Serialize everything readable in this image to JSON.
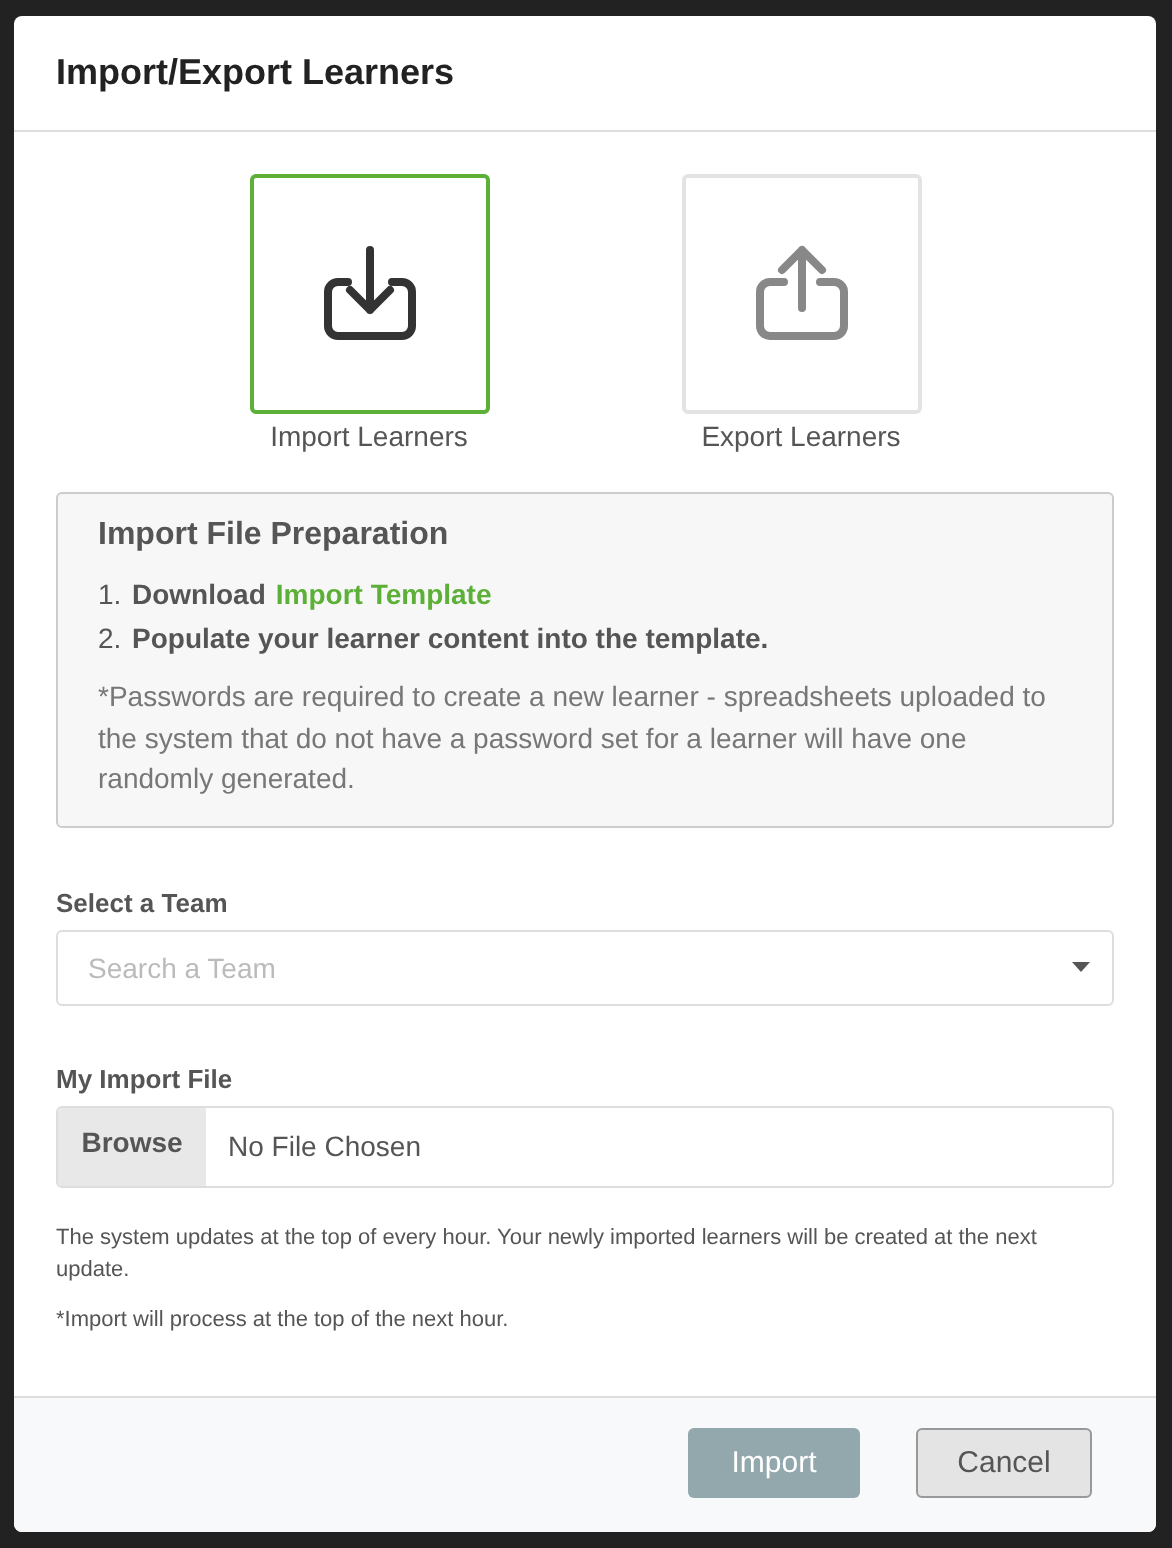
{
  "dialog": {
    "title": "Import/Export Learners"
  },
  "options": [
    {
      "kind": "import",
      "label": "Import Learners",
      "selected": true
    },
    {
      "kind": "export",
      "label": "Export Learners",
      "selected": false
    }
  ],
  "preparation": {
    "title": "Import File Preparation",
    "steps": [
      {
        "number": "1.",
        "text": "Download",
        "link": "Import Template"
      },
      {
        "number": "2.",
        "text": "Populate your learner content into the template."
      }
    ],
    "note": "*Passwords are required to create a new learner - spreadsheets uploaded to the system that do not have a password set for a learner will have one randomly generated."
  },
  "team": {
    "label": "Select a Team",
    "placeholder": "Search a Team"
  },
  "file": {
    "label": "My Import File",
    "button": "Browse",
    "value": "No File Chosen"
  },
  "notes": [
    "The system updates at the top of every hour. Your newly imported learners will be created at the next update.",
    "*Import will process at the top of the next hour."
  ],
  "buttons": [
    {
      "kind": "primary",
      "label": "Import",
      "disabled": true
    },
    {
      "kind": "secondary",
      "label": "Cancel",
      "disabled": false
    }
  ]
}
